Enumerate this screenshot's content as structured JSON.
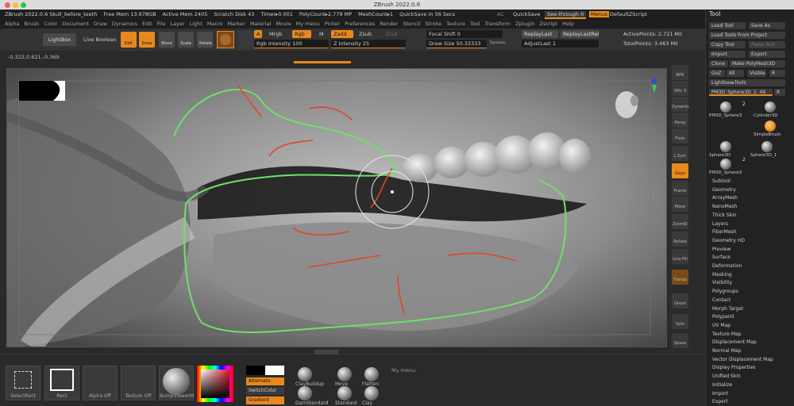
{
  "window": {
    "title": "ZBrush 2022.0.6"
  },
  "infobar": {
    "file": "ZBrush 2022.0.6 Skull_before_teeth",
    "free_mem": "Free Mem 13.978GB",
    "active_mem": "Active Mem 2405",
    "scratch": "Scratch Disk 43",
    "timer": "Timer▸0.001",
    "polycount": "PolyCount▸2.779 MP",
    "meshcount": "MeshCount▸1",
    "quicksave": "QuickSave In 56 Secs",
    "ac": "AC",
    "quicksave_btn": "QuickSave",
    "seethrough": "See-through  0",
    "menus": "Menus",
    "script": "DefaultZScript"
  },
  "menubar": [
    "Alpha",
    "Brush",
    "Color",
    "Document",
    "Draw",
    "Dynamics",
    "Edit",
    "File",
    "Layer",
    "Light",
    "Macro",
    "Marker",
    "Material",
    "Movie",
    "My menu",
    "Picker",
    "Preferences",
    "Render",
    "Stencil",
    "Stroke",
    "Texture",
    "Tool",
    "Transform",
    "Zplugin",
    "Zscript",
    "Help"
  ],
  "toolbar": {
    "lightbox": "LightBox",
    "live_boolean": "Live Boolean",
    "edit": "Edit",
    "draw": "Draw",
    "move": "Move",
    "scale": "Scale",
    "rotate": "Rotate",
    "a": "A",
    "mrgb": "Mrgb",
    "rgb": "Rgb",
    "m": "M",
    "zadd": "Zadd",
    "zsub": "Zsub",
    "zcut": "Zcut",
    "rgb_intensity": "Rgb Intensity 100",
    "z_intensity": "Z Intensity 25",
    "focal_shift": "Focal Shift 0",
    "draw_size": "Draw Size 50.33333",
    "dynamic": "Dynamic",
    "replaylast": "ReplayLast",
    "replaylastrel": "ReplayLastRel",
    "adjustlast": "AdjustLast 1",
    "active_points": "ActivePoints: 2.721 Mil",
    "total_points": "TotalPoints: 3.463 Mil",
    "coords": "-0.322,0.621,-0.369"
  },
  "rightdock": [
    "BPR",
    "SPix 3",
    "Dynamic",
    "Persp",
    "Floor",
    "L.Sym",
    "Gxyz",
    "Frame",
    "Move",
    "ZoomD",
    "Rotate",
    "Line Fill PolyF",
    "Transp",
    "Ghost",
    "Solo",
    "Xpose"
  ],
  "toolpanel": {
    "title": "Tool",
    "buttons": [
      {
        "label": "Load Tool"
      },
      {
        "label": "Save As"
      },
      {
        "label": "Load Tools From Project"
      },
      {
        "label": "Copy Tool"
      },
      {
        "label": "Paste Tool"
      },
      {
        "label": "Import"
      },
      {
        "label": "Export"
      },
      {
        "label": "Clone"
      },
      {
        "label": "Make PolyMesh3D"
      },
      {
        "label": "GoZ"
      },
      {
        "label": "All"
      },
      {
        "label": "Visible"
      },
      {
        "label": "R"
      },
      {
        "label": "Lightbox▸Tools"
      },
      {
        "label": "PM3D_Sphere3D_2. 49"
      },
      {
        "label": "R"
      }
    ],
    "thumbs": [
      {
        "label": "PM3D_Sphere3"
      },
      {
        "label": "Cylinder3D"
      },
      {
        "label": "SimpleBrush"
      },
      {
        "label": "Sphere3D"
      },
      {
        "label": "Sphere3D_1"
      },
      {
        "label": "PM3D_Sphere3"
      }
    ],
    "badge_a": "2",
    "badge_b": "2",
    "subpalettes": [
      "Subtool",
      "Geometry",
      "ArrayMesh",
      "NanoMesh",
      "Thick Skin",
      "Layers",
      "FiberMesh",
      "Geometry HD",
      "Preview",
      "Surface",
      "Deformation",
      "Masking",
      "Visibility",
      "Polygroups",
      "Contact",
      "Morph Target",
      "Polypaint",
      "UV Map",
      "Texture Map",
      "Displacement Map",
      "Normal Map",
      "Vector Displacement Map",
      "Display Properties",
      "Unified Skin",
      "Initialize",
      "Import",
      "Export"
    ]
  },
  "bottom": {
    "slots": [
      "SelectRect",
      "Rect",
      "Alpha Off",
      "Texture Off",
      "BumpViewerM"
    ],
    "alternate": "Alternate",
    "switchcolor": "SwitchColor",
    "gradient": "Gradient",
    "brushes": [
      "ClayBuildup",
      "Move",
      "Flatten",
      "DamStandard",
      "Standard",
      "Clay"
    ],
    "mymenu": "My menu"
  },
  "colors": {
    "accent": "#e8891e",
    "stroke_green": "#6fe06a",
    "stroke_red": "#e0452a"
  }
}
